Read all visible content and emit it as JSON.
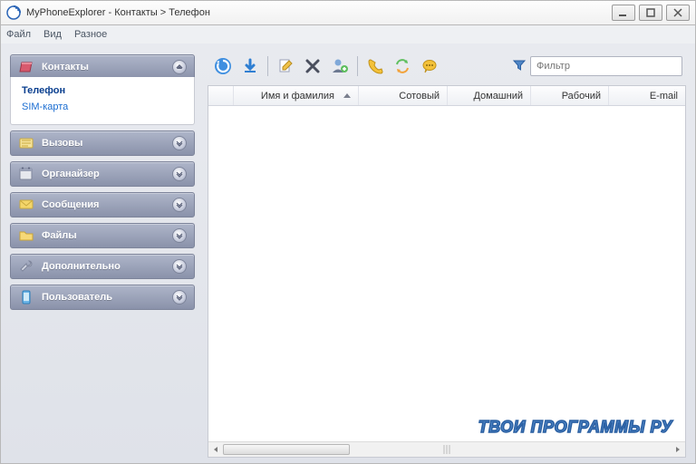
{
  "window": {
    "title": "MyPhoneExplorer -  Контакты > Телефон"
  },
  "menu": {
    "file": "Файл",
    "view": "Вид",
    "misc": "Разное"
  },
  "sidebar": {
    "contacts": {
      "label": "Контакты",
      "phone": "Телефон",
      "sim": "SIM-карта"
    },
    "calls": {
      "label": "Вызовы"
    },
    "organizer": {
      "label": "Органайзер"
    },
    "messages": {
      "label": "Сообщения"
    },
    "files": {
      "label": "Файлы"
    },
    "extras": {
      "label": "Дополнительно"
    },
    "user": {
      "label": "Пользователь"
    }
  },
  "toolbar": {
    "icons": {
      "refresh": "refresh-icon",
      "download": "download-icon",
      "edit": "edit-icon",
      "delete": "delete-icon",
      "adduser": "add-user-icon",
      "call": "call-icon",
      "sync": "sync-icon",
      "chat": "chat-icon",
      "filter": "filter-icon"
    },
    "filter_placeholder": "Фильтр"
  },
  "columns": {
    "name": "Имя и фамилия",
    "mobile": "Сотовый",
    "home": "Домашний",
    "work": "Рабочий",
    "email": "E-mail"
  },
  "watermark": "ТВОИ ПРОГРАММЫ РУ"
}
